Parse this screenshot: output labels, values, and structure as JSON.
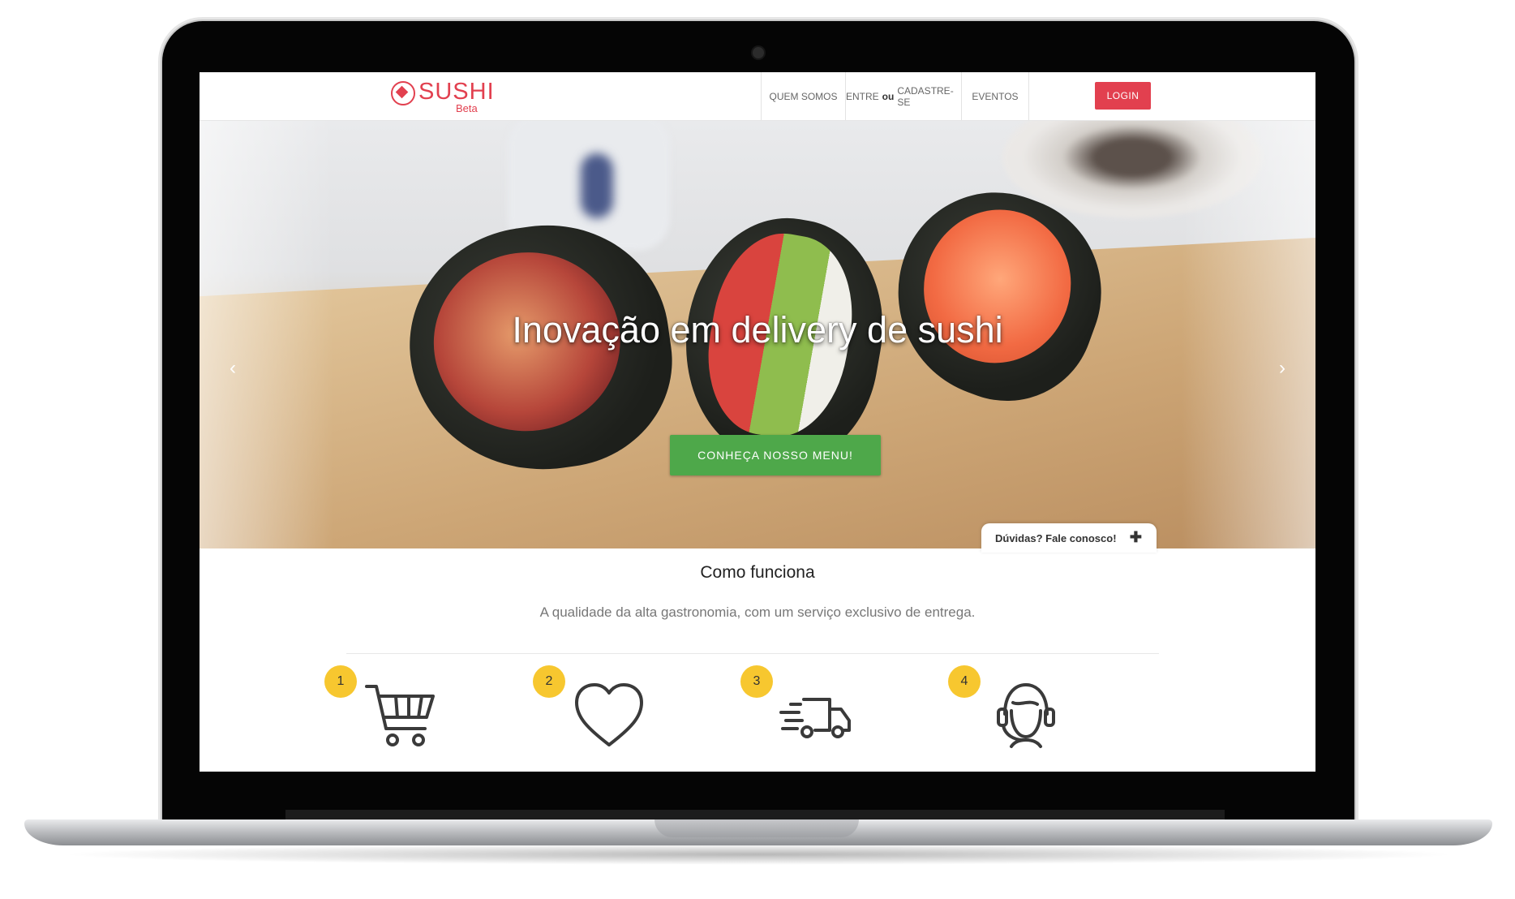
{
  "brand": {
    "name": "SUSHI",
    "tag": "Beta",
    "color": "#e2404f"
  },
  "nav": {
    "items": [
      {
        "label": "QUEM SOMOS"
      },
      {
        "label_pre": "ENTRE",
        "label_mid": "ou",
        "label_post": "CADASTRE-SE"
      },
      {
        "label": "EVENTOS"
      }
    ],
    "login_label": "LOGIN"
  },
  "hero": {
    "title": "Inovação em delivery de sushi",
    "cta_label": "CONHEÇA NOSSO MENU!",
    "cta_color": "#4ea84a",
    "prev_icon": "chevron-left-icon",
    "next_icon": "chevron-right-icon"
  },
  "chat": {
    "label": "Dúvidas? Fale conosco!",
    "icon": "plus-icon"
  },
  "how": {
    "title": "Como funciona",
    "subtitle": "A qualidade da alta gastronomia, com um serviço exclusivo de entrega.",
    "badge_color": "#f7c72f",
    "steps": [
      {
        "number": "1",
        "icon": "shopping-cart-icon"
      },
      {
        "number": "2",
        "icon": "heart-icon"
      },
      {
        "number": "3",
        "icon": "delivery-truck-icon"
      },
      {
        "number": "4",
        "icon": "support-headset-icon"
      }
    ]
  }
}
